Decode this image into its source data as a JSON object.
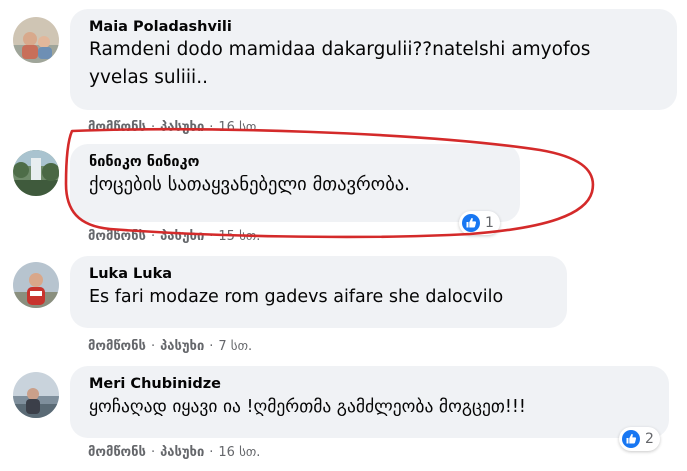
{
  "comments": [
    {
      "author": "Maia Poladashvili",
      "text": "Ramdeni dodo mamidaa dakargulii??natelshi amyofos yvelas suliii..",
      "like_label": "მომწონს",
      "reply_label": "პასუხი",
      "time": "16 სთ.",
      "reaction_count": null
    },
    {
      "author": "ნინიკო ნინიკო",
      "text": "ქოცების სათაყვანებელი მთავრობა.",
      "like_label": "მომწონს",
      "reply_label": "პასუხი",
      "time": "15 სთ.",
      "reaction_count": "1"
    },
    {
      "author": "Luka Luka",
      "text": "Es fari modaze rom gadevs aifare she dalocvilo",
      "like_label": "მომწონს",
      "reply_label": "პასუხი",
      "time": "7 სთ.",
      "reaction_count": null
    },
    {
      "author": "Meri Chubinidze",
      "text": "ყოჩაღად იყავი ია !ღმერთმა გამძლეობა მოგცეთ!!!",
      "like_label": "მომწონს",
      "reply_label": "პასუხი",
      "time": "16 სთ.",
      "reaction_count": "2"
    }
  ],
  "separator": "·",
  "colors": {
    "bubble": "#f0f2f5",
    "secondary_text": "#65676b",
    "like_blue": "#1877f2",
    "annotation_red": "#d42a2a"
  },
  "icons": {
    "like": "thumbs-up-icon"
  }
}
